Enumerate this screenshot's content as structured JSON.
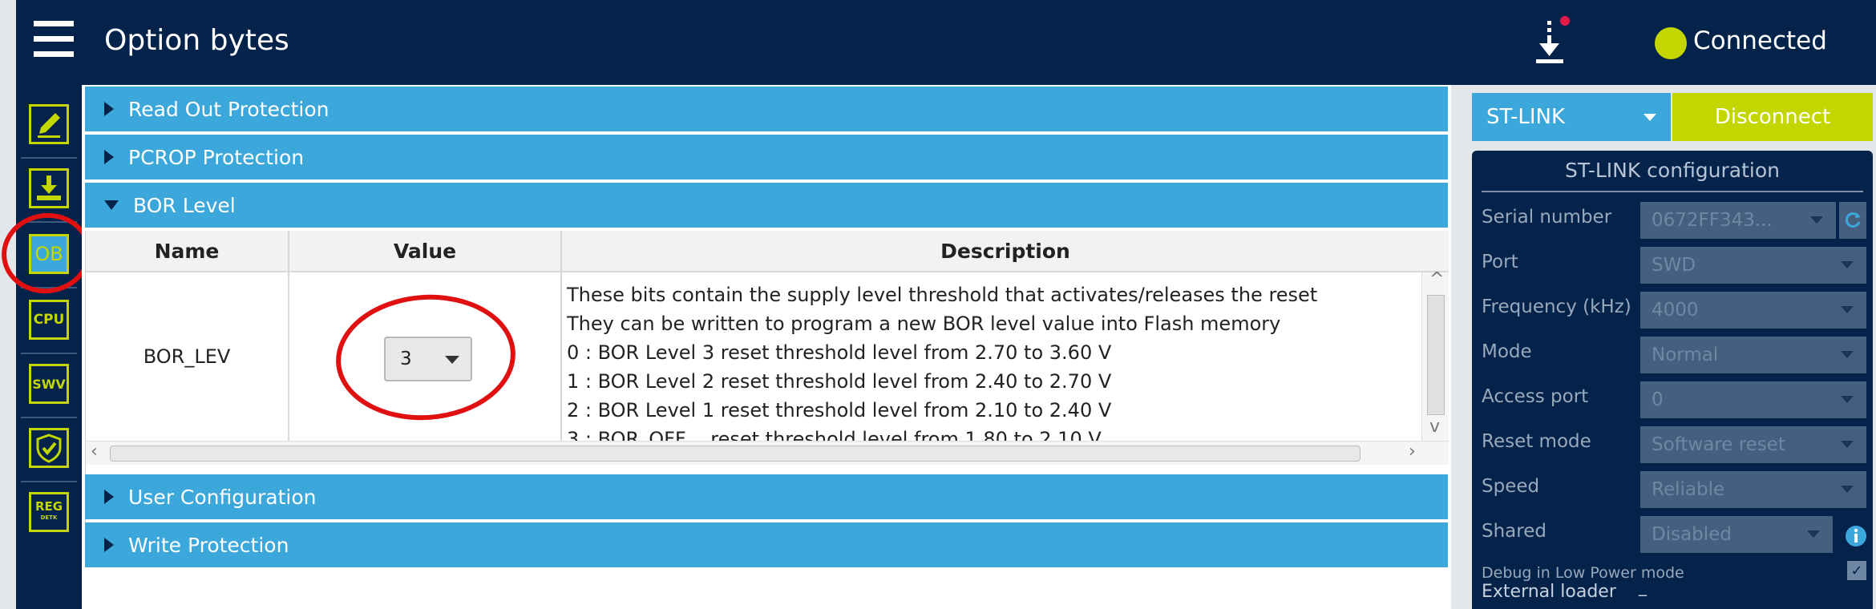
{
  "header": {
    "title": "Option bytes",
    "connection_status": "Connected",
    "status_color": "#c4d600"
  },
  "sidebar": {
    "items": [
      {
        "name": "edit-icon",
        "label": ""
      },
      {
        "name": "download-icon",
        "label": ""
      },
      {
        "name": "ob-icon",
        "label": "OB"
      },
      {
        "name": "cpu-icon",
        "label": "CPU"
      },
      {
        "name": "swv-icon",
        "label": "SWV"
      },
      {
        "name": "security-shield-icon",
        "label": ""
      },
      {
        "name": "reg-icon",
        "label": "REG",
        "sublabel": "DETK"
      }
    ]
  },
  "sections": {
    "read_out": "Read Out Protection",
    "pcrop": "PCROP Protection",
    "bor": "BOR Level",
    "user_config": "User Configuration",
    "write_protection": "Write Protection"
  },
  "table": {
    "headers": {
      "name": "Name",
      "value": "Value",
      "description": "Description"
    },
    "row": {
      "name": "BOR_LEV",
      "value": "3",
      "description": [
        "These bits contain the supply level threshold that activates/releases the reset",
        "They can be written to program a new BOR level value into Flash memory",
        "0 : BOR Level 3 reset threshold level from 2.70 to 3.60 V",
        "1 : BOR Level 2 reset threshold level from 2.40 to 2.70 V",
        "2 : BOR Level 1 reset threshold level from 2.10 to 2.40 V",
        "3 : BOR_OFF    reset threshold level from 1.80 to 2.10 V"
      ]
    }
  },
  "right_panel": {
    "interface": "ST-LINK",
    "disconnect_label": "Disconnect",
    "config_title": "ST-LINK configuration",
    "fields": {
      "serial_number": {
        "label": "Serial number",
        "value": "0672FF343..."
      },
      "port": {
        "label": "Port",
        "value": "SWD"
      },
      "frequency": {
        "label": "Frequency (kHz)",
        "value": "4000"
      },
      "mode": {
        "label": "Mode",
        "value": "Normal"
      },
      "access_port": {
        "label": "Access port",
        "value": "0"
      },
      "reset_mode": {
        "label": "Reset mode",
        "value": "Software reset"
      },
      "speed": {
        "label": "Speed",
        "value": "Reliable"
      },
      "shared": {
        "label": "Shared",
        "value": "Disabled"
      }
    },
    "debug_low_power_label": "Debug in Low Power mode",
    "debug_low_power_checked": true,
    "external_loader_label": "External loader",
    "external_loader_value": "_"
  }
}
